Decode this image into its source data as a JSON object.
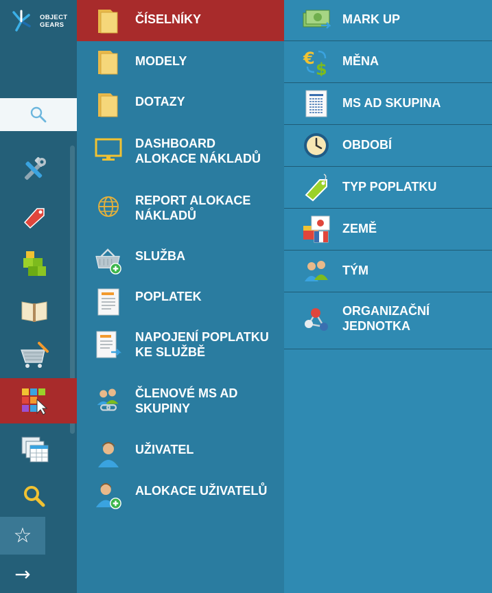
{
  "brand": {
    "line1": "OBJECT",
    "line2": "GEARS"
  },
  "rail": {
    "items": [
      {
        "icon": "tools-icon"
      },
      {
        "icon": "tag-icon"
      },
      {
        "icon": "cubes-icon"
      },
      {
        "icon": "book-icon"
      },
      {
        "icon": "cart-icon"
      },
      {
        "icon": "apps-grid-icon"
      },
      {
        "icon": "tables-icon"
      },
      {
        "icon": "search-icon"
      }
    ],
    "bottom": [
      {
        "icon": "star-icon",
        "glyph": "☆"
      },
      {
        "icon": "arrow-right-icon",
        "glyph": "→"
      }
    ]
  },
  "middle": {
    "items": [
      {
        "label": "ČÍSELNÍKY",
        "icon": "folder-icon"
      },
      {
        "label": "MODELY",
        "icon": "folder-icon"
      },
      {
        "label": "DOTAZY",
        "icon": "folder-icon"
      },
      {
        "label": "DASHBOARD ALOKACE NÁKLADŮ",
        "icon": "monitor-icon"
      },
      {
        "label": "REPORT ALOKACE NÁKLADŮ",
        "icon": "globe-icon"
      },
      {
        "label": "SLUŽBA",
        "icon": "basket-add-icon"
      },
      {
        "label": "POPLATEK",
        "icon": "document-icon"
      },
      {
        "label": "NAPOJENÍ POPLATKU KE SLUŽBĚ",
        "icon": "document-link-icon"
      },
      {
        "label": "ČLENOVÉ MS AD SKUPINY",
        "icon": "users-link-icon"
      },
      {
        "label": "UŽIVATEL",
        "icon": "user-icon"
      },
      {
        "label": "ALOKACE UŽIVATELŮ",
        "icon": "user-add-icon"
      }
    ]
  },
  "right": {
    "items": [
      {
        "label": "MARK UP",
        "icon": "money-icon"
      },
      {
        "label": "MĚNA",
        "icon": "currency-exchange-icon"
      },
      {
        "label": "MS AD SKUPINA",
        "icon": "list-document-icon"
      },
      {
        "label": "OBDOBÍ",
        "icon": "clock-icon"
      },
      {
        "label": "TYP POPLATKU",
        "icon": "price-tag-icon"
      },
      {
        "label": "ZEMĚ",
        "icon": "flags-icon"
      },
      {
        "label": "TÝM",
        "icon": "team-icon"
      },
      {
        "label": "ORGANIZAČNÍ JEDNOTKA",
        "icon": "org-unit-icon"
      }
    ]
  }
}
